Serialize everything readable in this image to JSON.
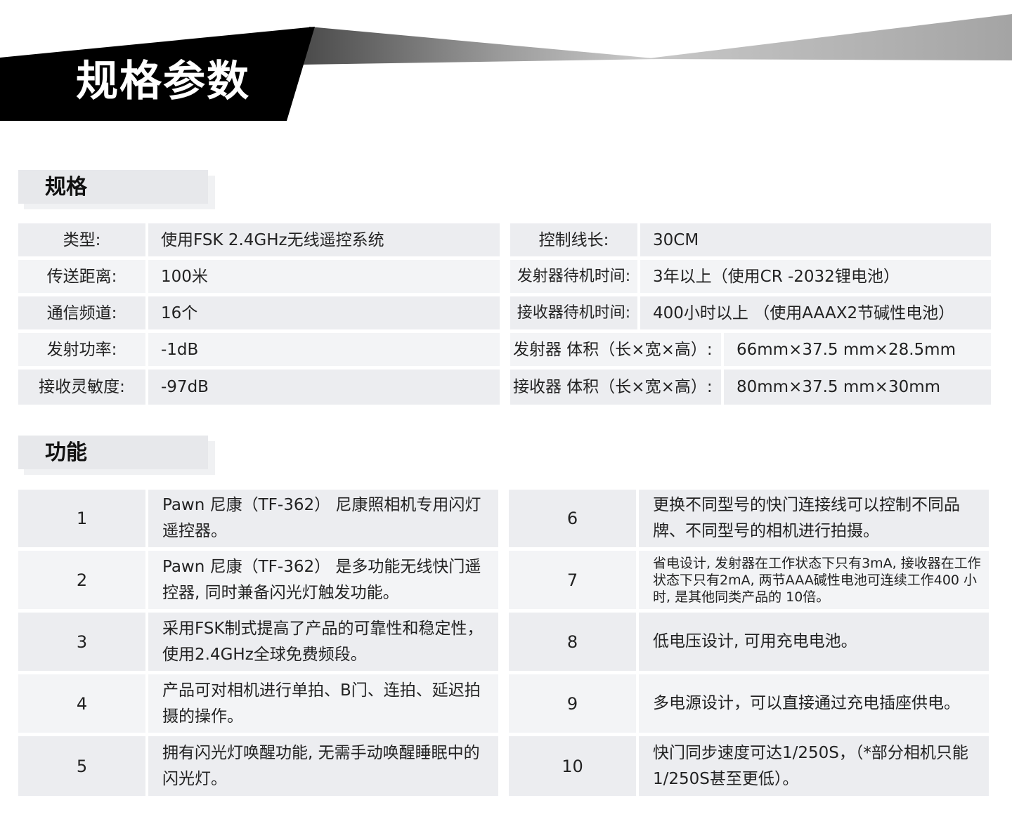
{
  "banner": {
    "title": "规格参数"
  },
  "spec_section": {
    "title": "规格"
  },
  "spec_left": [
    {
      "label": "类型:",
      "value": "使用FSK 2.4GHz无线遥控系统"
    },
    {
      "label": "传送距离:",
      "value": "100米"
    },
    {
      "label": "通信频道:",
      "value": "16个"
    },
    {
      "label": "发射功率:",
      "value": "-1dB"
    },
    {
      "label": "接收灵敏度:",
      "value": "-97dB"
    }
  ],
  "spec_right": [
    {
      "label": "控制线长:",
      "value": "30CM"
    },
    {
      "label": "发射器待机时间:",
      "value": "3年以上（使用CR -2032锂电池）"
    },
    {
      "label": "接收器待机时间:",
      "value": "400小时以上 （使用AAAX2节碱性电池）"
    },
    {
      "label": "发射器 体积（长×宽×高）:",
      "value": "66mm×37.5 mm×28.5mm"
    },
    {
      "label": "接收器 体积（长×宽×高）:",
      "value": "80mm×37.5 mm×30mm"
    }
  ],
  "feature_section": {
    "title": "功能"
  },
  "features_left": [
    {
      "num": "1",
      "text": "Pawn 尼康（TF-362） 尼康照相机专用闪灯遥控器。"
    },
    {
      "num": "2",
      "text": "Pawn 尼康（TF-362）   是多功能无线快门遥控器, 同时兼备闪光灯触发功能。"
    },
    {
      "num": "3",
      "text": "采用FSK制式提高了产品的可靠性和稳定性，使用2.4GHz全球免费频段。"
    },
    {
      "num": "4",
      "text": "产品可对相机进行单拍、B门、连拍、延迟拍摄的操作。"
    },
    {
      "num": "5",
      "text": "拥有闪光灯唤醒功能, 无需手动唤醒睡眠中的闪光灯。"
    }
  ],
  "features_right": [
    {
      "num": "6",
      "text": "更换不同型号的快门连接线可以控制不同品牌、不同型号的相机进行拍摄。"
    },
    {
      "num": "7",
      "text": "省电设计, 发射器在工作状态下只有3mA, 接收器在工作状态下只有2mA,   两节AAA碱性电池可连续工作400 小时, 是其他同类产品的 10倍。"
    },
    {
      "num": "8",
      "text": "低电压设计, 可用充电电池。"
    },
    {
      "num": "9",
      "text": "多电源设计，可以直接通过充电插座供电。"
    },
    {
      "num": "10",
      "text": "快门同步速度可达1/250S，（*部分相机只能1/250S甚至更低）。"
    }
  ]
}
